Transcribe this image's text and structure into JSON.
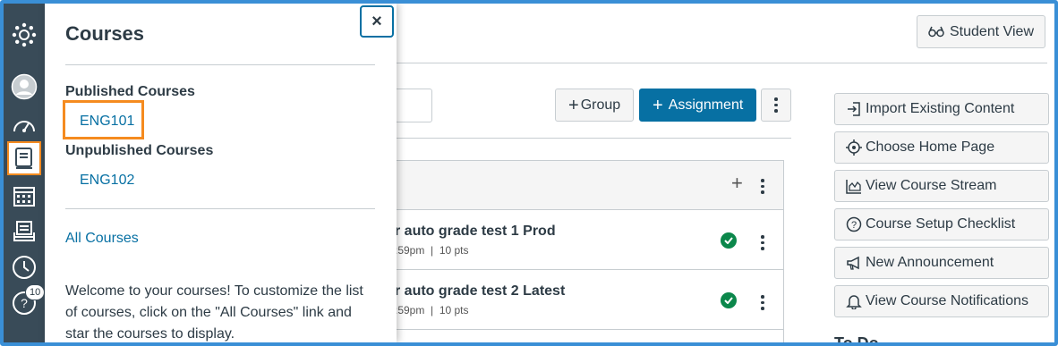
{
  "nav": {
    "badge_count": "10",
    "icons": [
      "canvas-logo-icon",
      "account-icon",
      "dashboard-icon",
      "courses-icon",
      "calendar-icon",
      "inbox-icon",
      "history-icon",
      "help-icon"
    ],
    "highlight_color": "#f58b1f"
  },
  "tray": {
    "title": "Courses",
    "close_label": "×",
    "published_heading": "Published Courses",
    "published": [
      "ENG101"
    ],
    "unpublished_heading": "Unpublished Courses",
    "unpublished": [
      "ENG102"
    ],
    "all_courses_label": "All Courses",
    "welcome_text": "Welcome to your courses! To customize the list of courses, click on the \"All Courses\" link and star the courses to display."
  },
  "toolbar": {
    "student_view_label": "Student View",
    "group_label": "Group",
    "assignment_label": "Assignment"
  },
  "assignments": [
    {
      "title": "r auto grade test 1 Prod",
      "meta_time": ":59pm",
      "meta_pts": "10 pts"
    },
    {
      "title": "r auto grade test 2 Latest",
      "meta_time": ":59pm",
      "meta_pts": "10 pts"
    }
  ],
  "sidebar": {
    "buttons": [
      {
        "label": "Import Existing Content",
        "icon": "import-icon"
      },
      {
        "label": "Choose Home Page",
        "icon": "target-icon"
      },
      {
        "label": "View Course Stream",
        "icon": "stream-chart-icon"
      },
      {
        "label": "Course Setup Checklist",
        "icon": "question-icon"
      },
      {
        "label": "New Announcement",
        "icon": "megaphone-icon"
      },
      {
        "label": "View Course Notifications",
        "icon": "bell-icon"
      }
    ],
    "todo_label": "To Do"
  },
  "colors": {
    "primary": "#0770a3",
    "success": "#0b874b",
    "nav_bg": "#394b58"
  }
}
